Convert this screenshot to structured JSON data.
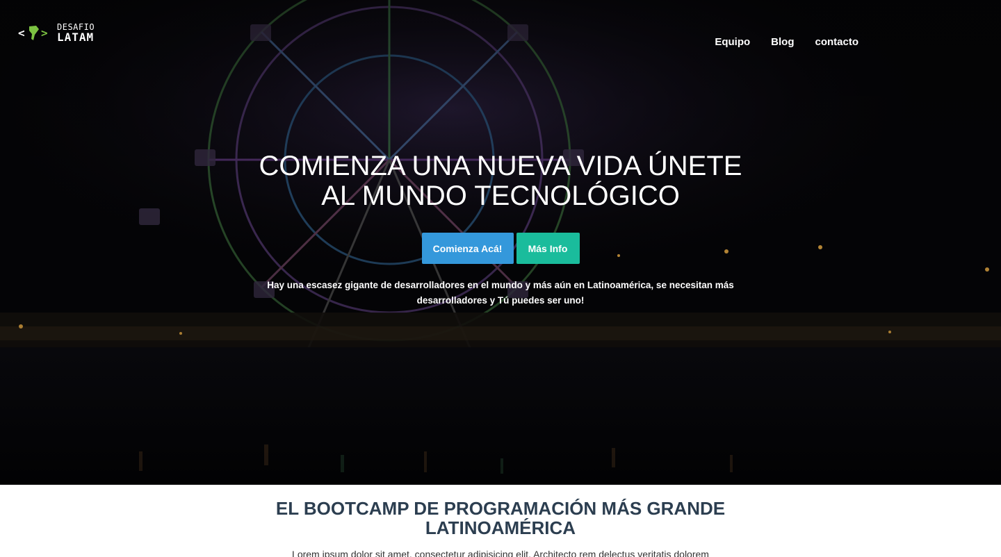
{
  "logo": {
    "top": "DESAFIO",
    "bottom": "LATAM"
  },
  "nav": {
    "items": [
      {
        "label": "Equipo"
      },
      {
        "label": "Blog"
      },
      {
        "label": "contacto"
      }
    ]
  },
  "hero": {
    "headline_line1": "COMIENZA UNA NUEVA VIDA ÚNETE",
    "headline_line2": "AL MUNDO TECNOLÓGICO",
    "primary_button": "Comienza Acá!",
    "secondary_button": "Más Info",
    "text_line1": "Hay una escasez gigante de desarrolladores en el mundo y más aún en Latinoamérica, se necesitan más",
    "text_line2": "desarrolladores y Tú puedes ser uno!"
  },
  "section": {
    "title_line1": "EL BOOTCAMP DE PROGRAMACIÓN MÁS GRANDE",
    "title_line2": "LATINOAMÉRICA",
    "text": "Lorem ipsum dolor sit amet, consectetur adipisicing elit. Architecto rem delectus veritatis dolorem"
  },
  "colors": {
    "primary_button": "#3498db",
    "secondary_button": "#1abc9c",
    "section_title": "#2c3e50",
    "logo_green": "#7cc242"
  }
}
